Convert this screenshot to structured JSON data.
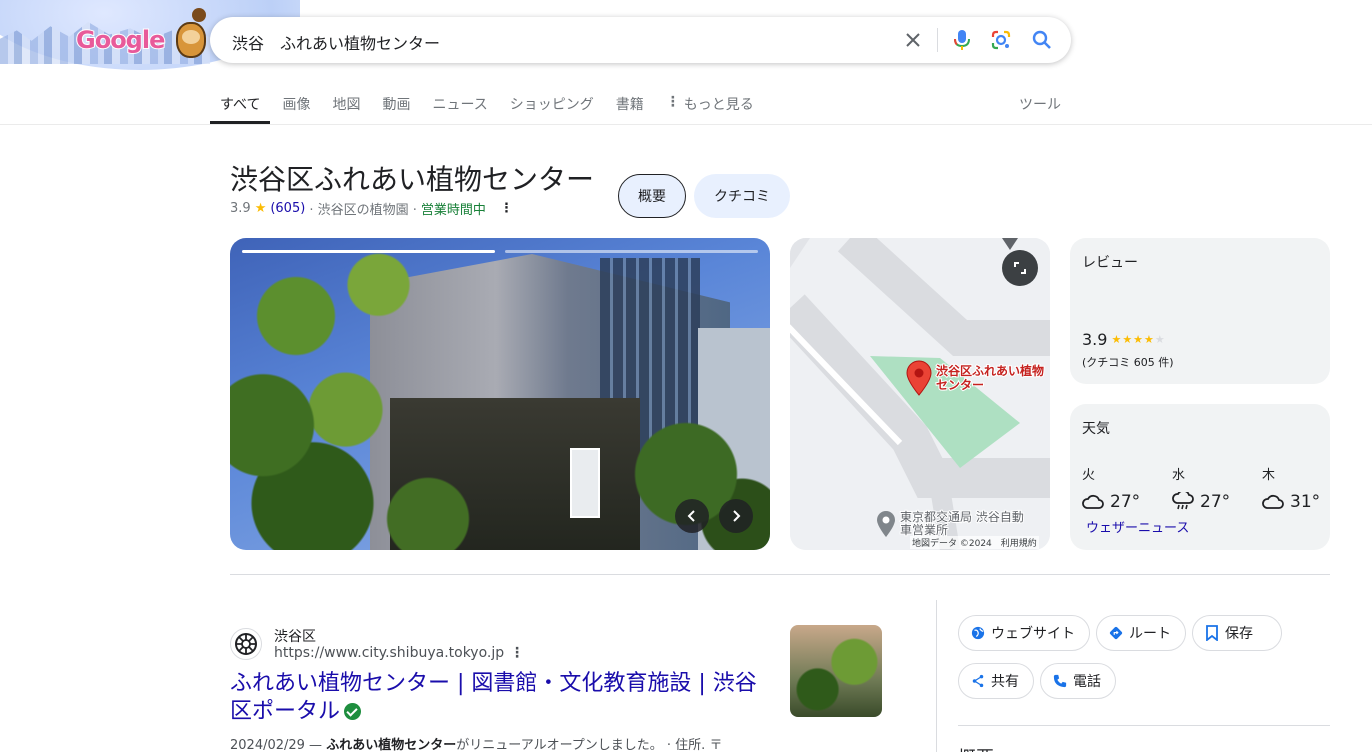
{
  "header": {
    "logo_text": "Google",
    "search_query": "渋谷　ふれあい植物センター",
    "icons": [
      "clear-icon",
      "microphone-icon",
      "lens-icon",
      "search-icon"
    ]
  },
  "tabs": [
    {
      "label": "すべて",
      "active": true
    },
    {
      "label": "画像"
    },
    {
      "label": "地図"
    },
    {
      "label": "動画"
    },
    {
      "label": "ニュース"
    },
    {
      "label": "ショッピング"
    },
    {
      "label": "書籍"
    },
    {
      "label": "もっと見る"
    }
  ],
  "tools_label": "ツール",
  "place": {
    "title": "渋谷区ふれあい植物センター",
    "rating": "3.9",
    "star": "★",
    "review_count": "(605)",
    "category": "· 渋谷区の植物園 ·",
    "status": "営業時間中",
    "chip_overview": "概要",
    "chip_reviews": "クチコミ"
  },
  "map": {
    "pin_label": "渋谷区ふれあい植物センター",
    "poi_label": "東京都交通局 渋谷自動車営業所",
    "credit": "地図データ ©2024　利用規約"
  },
  "review_card": {
    "label": "レビュー",
    "score": "3.9",
    "stars_filled": "★★★★",
    "stars_empty": "★",
    "count": "(クチコミ 605 件)"
  },
  "weather_card": {
    "label": "天気",
    "days": [
      {
        "day": "火",
        "temp": "27°",
        "icon": "cloud-icon"
      },
      {
        "day": "水",
        "temp": "27°",
        "icon": "rain-icon"
      },
      {
        "day": "木",
        "temp": "31°",
        "icon": "cloud-icon"
      }
    ],
    "link": "ウェザーニュース"
  },
  "result": {
    "site_name": "渋谷区",
    "url": "https://www.city.shibuya.tokyo.jp",
    "title": "ふれあい植物センター | 図書館・文化教育施設 | 渋谷区ポータル",
    "snippet_date": "2024/02/29 —",
    "snippet_bold": "ふれあい植物センター",
    "snippet_rest": "がリニューアルオープンしました。 · 住所. 〒"
  },
  "actions": {
    "website": "ウェブサイト",
    "route": "ルート",
    "save": "保存",
    "share": "共有",
    "call": "電話",
    "section_heading": "概要"
  },
  "colors": {
    "link": "#1a0dab",
    "open": "#188038",
    "star": "#fbbc04",
    "chip_bg": "#e8f0fe",
    "pin": "#ea4335"
  }
}
